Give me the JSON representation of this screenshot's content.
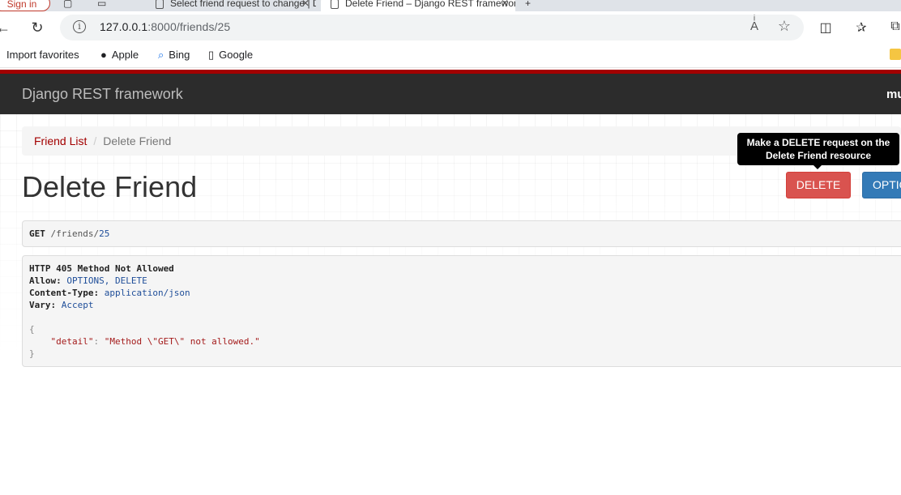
{
  "browser": {
    "tabs": {
      "signin_label": "Sign in",
      "tab1_title": "Select friend request to change | Django site admin",
      "tab2_title": "Delete Friend – Django REST framework"
    },
    "url_host": "127.0.0.1",
    "url_path": ":8000/friends/25",
    "favorites": {
      "import": "Import favorites",
      "apple": "Apple",
      "bing": "Bing",
      "google": "Google"
    }
  },
  "drf": {
    "brand": "Django REST framework",
    "user": "mu",
    "breadcrumb": {
      "link": "Friend List",
      "separator": "/",
      "active": "Delete Friend"
    },
    "title": "Delete Friend",
    "tooltip_line1": "Make a DELETE request on the",
    "tooltip_line2": "Delete Friend resource",
    "delete_label": "DELETE",
    "options_label": "OPTIONS",
    "request": {
      "method": "GET",
      "path_prefix": " /friends/",
      "path_id": "25"
    },
    "response": {
      "status": "HTTP 405 Method Not Allowed",
      "allow_key": "Allow:",
      "allow_value": "OPTIONS, DELETE",
      "ctype_key": "Content-Type:",
      "ctype_value": "application/json",
      "vary_key": "Vary:",
      "vary_value": "Accept",
      "open_brace": "{",
      "detail_key": "\"detail\"",
      "colon": ": ",
      "detail_value": "\"Method \\\"GET\\\" not allowed.\"",
      "close_brace": "}"
    }
  },
  "colors": {
    "brand_red": "#a30000",
    "navbar_bg": "#2c2c2c",
    "danger": "#d9534f",
    "primary": "#337ab7"
  }
}
